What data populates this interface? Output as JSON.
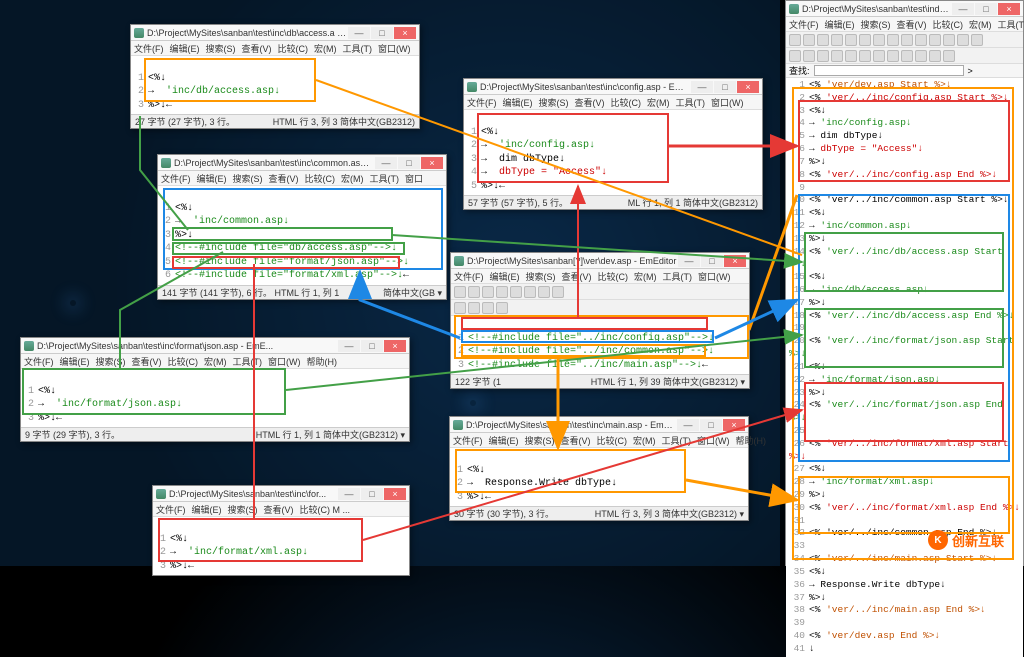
{
  "app_name": "EmEditor",
  "menus": {
    "file": "文件(F)",
    "edit": "编辑(E)",
    "search": "搜索(S)",
    "view": "查看(V)",
    "compare": "比较(C)",
    "macros": "宏(M)",
    "tools": "工具(T)",
    "window": "窗口(W)",
    "help": "帮助(H)"
  },
  "win": {
    "min": "—",
    "max": "□",
    "close": "×"
  },
  "findbar": {
    "label": "查找:",
    "btn": ">"
  },
  "access": {
    "title": "D:\\Project\\MySites\\sanban\\test\\inc\\db\\access.a - EmE...",
    "l1": "<%↓",
    "l2": "'inc/db/access.asp↓",
    "l3": "%>↓",
    "status_l": "27 字节 (27 字节), 3 行。",
    "status_r": "HTML  行 3, 列 3    简体中文(GB2312)"
  },
  "common": {
    "title": "D:\\Project\\MySites\\sanban\\test\\inc\\common.asp ...",
    "l1": "<%↓",
    "l2": "'inc/common.asp↓",
    "l3": "%>↓",
    "l4": "<!--#include file=\"db/access.asp\"-->↓",
    "l5": "<!--#include file=\"format/json.asp\"-->↓",
    "l6": "<!--#include file=\"format/xml.asp\"-->↓",
    "status_l": "141 字节 (141 字节), 6 行。 HTML  行 1, 列 1",
    "status_r": "简体中文(GB ▾"
  },
  "json": {
    "title": "D:\\Project\\MySites\\sanban\\test\\inc\\format\\json.asp - EmE...",
    "l1": "<%↓",
    "l2": "'inc/format/json.asp↓",
    "l3": "%>↓",
    "status_l": "9 字节 (29 字节), 3 行。",
    "status_r": "HTML  行 1, 列 1    简体中文(GB2312) ▾"
  },
  "xml": {
    "title": "D:\\Project\\MySites\\sanban\\test\\inc\\for...",
    "l1": "<%↓",
    "l2": "'inc/format/xml.asp↓",
    "l3": "%>↓",
    "menu_rest": "比较(C)  M ..."
  },
  "config": {
    "title": "D:\\Project\\MySites\\sanban\\test\\inc\\config.asp - EmEditor",
    "l1": "<%↓",
    "l2": "'inc/config.asp↓",
    "l3": "dim dbType↓",
    "l4": "dbType = \"Access\"↓",
    "l5": "%>↓",
    "status_l": "57 字节 (57 字节), 5 行。",
    "status_r": "ML  行 1, 列 1    简体中文(GB2312)"
  },
  "dev": {
    "title": "D:\\Project\\MySites\\sanban[?]\\ver\\dev.asp - EmEditor",
    "l1": "<!--#include file=\"../inc/config.asp\"-->↓",
    "l2": "<!--#include file=\"../inc/common.asp\"-->↓",
    "l3": "<!--#include file=\"../inc/main.asp\"-->↓",
    "status_l": "122 字节 (1",
    "status_r": "HTML  行 1, 列 39    简体中文(GB2312) ▾"
  },
  "main": {
    "title": "D:\\Project\\MySites\\sanban\\test\\inc\\main.asp - EmEditor",
    "l1": "<%↓",
    "l2": "Response.Write dbType↓",
    "l3": "%>↓",
    "status_l": "30 字节 (30 字节), 3 行。",
    "status_r": "HTML  行 3, 列 3    简体中文(GB2312) ▾"
  },
  "index": {
    "title": "D:\\Project\\MySites\\sanban\\test\\index.asp - EmEditor",
    "lines": [
      {
        "n": "1",
        "pre": "<% ",
        "t": "'ver/dev.asp Start %>↓",
        "cls": "orange"
      },
      {
        "n": "2",
        "pre": "<% ",
        "t": "'ver/../inc/config.asp Start %>↓",
        "cls": "red"
      },
      {
        "n": "3",
        "pre": "",
        "t": "<%↓",
        "cls": ""
      },
      {
        "n": "4",
        "pre": "→  ",
        "t": "'inc/config.asp↓",
        "cls": "green"
      },
      {
        "n": "5",
        "pre": "→  ",
        "t": "dim dbType↓",
        "cls": ""
      },
      {
        "n": "6",
        "pre": "→  ",
        "t": "dbType = \"Access\"↓",
        "cls": "red"
      },
      {
        "n": "7",
        "pre": "",
        "t": "%>↓",
        "cls": ""
      },
      {
        "n": "8",
        "pre": "<% ",
        "t": "'ver/../inc/config.asp End %>↓",
        "cls": "red"
      },
      {
        "n": "9",
        "pre": "",
        "t": "",
        "cls": ""
      },
      {
        "n": "10",
        "pre": "<% ",
        "t": "'ver/../inc/common.asp Start %>↓",
        "cls": ""
      },
      {
        "n": "11",
        "pre": "",
        "t": "<%↓",
        "cls": ""
      },
      {
        "n": "12",
        "pre": "→  ",
        "t": "'inc/common.asp↓",
        "cls": "green"
      },
      {
        "n": "13",
        "pre": "",
        "t": "%>↓",
        "cls": ""
      },
      {
        "n": "14",
        "pre": "<% ",
        "t": "'ver/../inc/db/access.asp Start %>↓",
        "cls": "green"
      },
      {
        "n": "15",
        "pre": "",
        "t": "<%↓",
        "cls": ""
      },
      {
        "n": "16",
        "pre": "→  ",
        "t": "'inc/db/access.asp↓",
        "cls": "green"
      },
      {
        "n": "17",
        "pre": "",
        "t": "%>↓",
        "cls": ""
      },
      {
        "n": "18",
        "pre": "<% ",
        "t": "'ver/../inc/db/access.asp End %>↓",
        "cls": "green"
      },
      {
        "n": "19",
        "pre": "",
        "t": "",
        "cls": ""
      },
      {
        "n": "20",
        "pre": "<% ",
        "t": "'ver/../inc/format/json.asp Start %>↓",
        "cls": "green"
      },
      {
        "n": "21",
        "pre": "",
        "t": "<%↓",
        "cls": ""
      },
      {
        "n": "22",
        "pre": "→  ",
        "t": "'inc/format/json.asp↓",
        "cls": "green"
      },
      {
        "n": "23",
        "pre": "",
        "t": "%>↓",
        "cls": ""
      },
      {
        "n": "24",
        "pre": "<% ",
        "t": "'ver/../inc/format/json.asp End %>↓",
        "cls": "green"
      },
      {
        "n": "25",
        "pre": "",
        "t": "",
        "cls": ""
      },
      {
        "n": "26",
        "pre": "<% ",
        "t": "'ver/../inc/format/xml.asp Start %>↓",
        "cls": "red"
      },
      {
        "n": "27",
        "pre": "",
        "t": "<%↓",
        "cls": ""
      },
      {
        "n": "28",
        "pre": "→  ",
        "t": "'inc/format/xml.asp↓",
        "cls": "green"
      },
      {
        "n": "29",
        "pre": "",
        "t": "%>↓",
        "cls": ""
      },
      {
        "n": "30",
        "pre": "<% ",
        "t": "'ver/../inc/format/xml.asp End %>↓",
        "cls": "red"
      },
      {
        "n": "31",
        "pre": "",
        "t": "",
        "cls": ""
      },
      {
        "n": "32",
        "pre": "<% ",
        "t": "'ver/../inc/common.asp End %>↓",
        "cls": ""
      },
      {
        "n": "33",
        "pre": "",
        "t": "",
        "cls": ""
      },
      {
        "n": "34",
        "pre": "<% ",
        "t": "'ver/../inc/main.asp Start %>↓",
        "cls": "orange"
      },
      {
        "n": "35",
        "pre": "",
        "t": "<%↓",
        "cls": ""
      },
      {
        "n": "36",
        "pre": "→  ",
        "t": "Response.Write dbType↓",
        "cls": ""
      },
      {
        "n": "37",
        "pre": "",
        "t": "%>↓",
        "cls": ""
      },
      {
        "n": "38",
        "pre": "<% ",
        "t": "'ver/../inc/main.asp End %>↓",
        "cls": "orange"
      },
      {
        "n": "39",
        "pre": "",
        "t": "",
        "cls": ""
      },
      {
        "n": "40",
        "pre": "<% ",
        "t": "'ver/dev.asp End %>↓",
        "cls": "orange"
      },
      {
        "n": "41",
        "pre": "",
        "t": "↓",
        "cls": ""
      }
    ]
  },
  "watermark": "创新互联"
}
